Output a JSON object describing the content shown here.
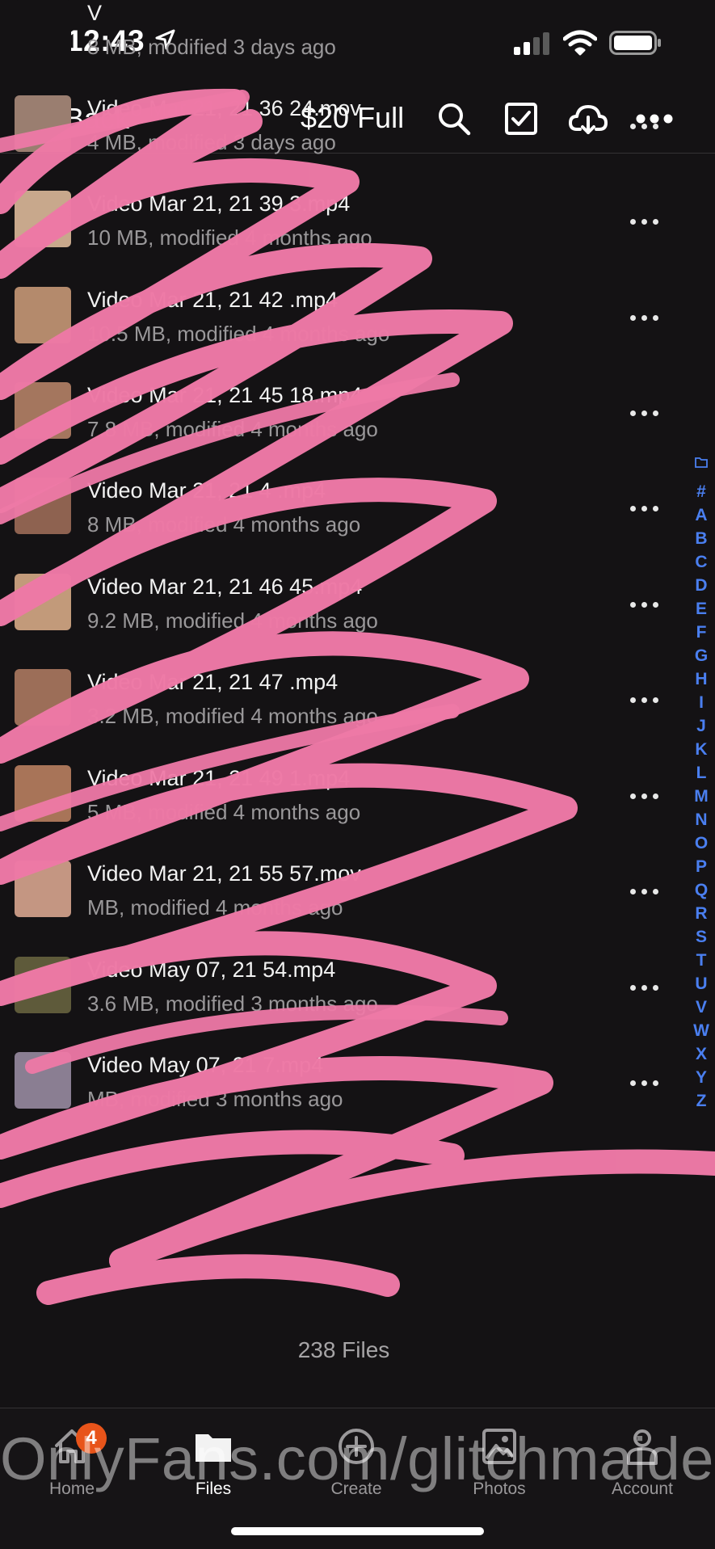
{
  "status_bar": {
    "time": "12:43"
  },
  "nav": {
    "back_label": "Back",
    "folder_title": "$20 Full"
  },
  "files": [
    {
      "name": "V",
      "meta": "8 MB, modified 3 days ago",
      "thumb_color": "#141214"
    },
    {
      "name": "Video Mar 21, 21 36 24.mov",
      "meta": "4 MB, modified 3 days ago",
      "thumb_color": "#9a7e70"
    },
    {
      "name": "Video Mar 21, 21 39 3.mp4",
      "meta": "10 MB, modified 4 months ago",
      "thumb_color": "#c8a88c"
    },
    {
      "name": "Video Mar 21, 21 42 .mp4",
      "meta": "10.5 MB, modified 4 months ago",
      "thumb_color": "#b48a6c"
    },
    {
      "name": "Video Mar 21, 21 45 18.mp4",
      "meta": "7.8 MB, modified 4 months ago",
      "thumb_color": "#a4765e"
    },
    {
      "name": "Video Mar 21, 21 4 .mp4",
      "meta": "8 MB, modified 4 months ago",
      "thumb_color": "#8e6250"
    },
    {
      "name": "Video Mar 21, 21 46 45.mp4",
      "meta": "9.2 MB, modified 4 months ago",
      "thumb_color": "#c29a7a"
    },
    {
      "name": "Video Mar 21, 21 47 .mp4",
      "meta": "3.2 MB, modified 4 months ago",
      "thumb_color": "#9c6e58"
    },
    {
      "name": "Video Mar 21, 21 49 1.mp4",
      "meta": "5 MB, modified 4 months ago",
      "thumb_color": "#a87458"
    },
    {
      "name": "Video Mar 21, 21 55 57.mov",
      "meta": "MB, modified 4 months ago",
      "thumb_color": "#c49682"
    },
    {
      "name": "Video May 07, 21 54.mp4",
      "meta": "3.6 MB, modified 3 months ago",
      "thumb_color": "#5e5a3a"
    },
    {
      "name": "Video May 07, 21 7.mp4",
      "meta": "MB, modified 3 months ago",
      "thumb_color": "#8a7e92"
    }
  ],
  "index_letters": [
    "#",
    "A",
    "B",
    "C",
    "D",
    "E",
    "F",
    "G",
    "H",
    "I",
    "J",
    "K",
    "L",
    "M",
    "N",
    "O",
    "P",
    "Q",
    "R",
    "S",
    "T",
    "U",
    "V",
    "W",
    "X",
    "Y",
    "Z"
  ],
  "footer": {
    "count": "238 Files"
  },
  "tabs": [
    {
      "label": "Home",
      "icon": "home-icon",
      "badge": "4"
    },
    {
      "label": "Files",
      "icon": "folder-icon"
    },
    {
      "label": "Create",
      "icon": "plus-circle-icon"
    },
    {
      "label": "Photos",
      "icon": "photo-icon"
    },
    {
      "label": "Account",
      "icon": "person-icon"
    }
  ],
  "watermark": "OnlyFans.com/glitchmaiden",
  "colors": {
    "index_accent": "#4a7ff0",
    "scribble": "#ee79a6",
    "badge": "#e8541a",
    "background": "#141214"
  }
}
